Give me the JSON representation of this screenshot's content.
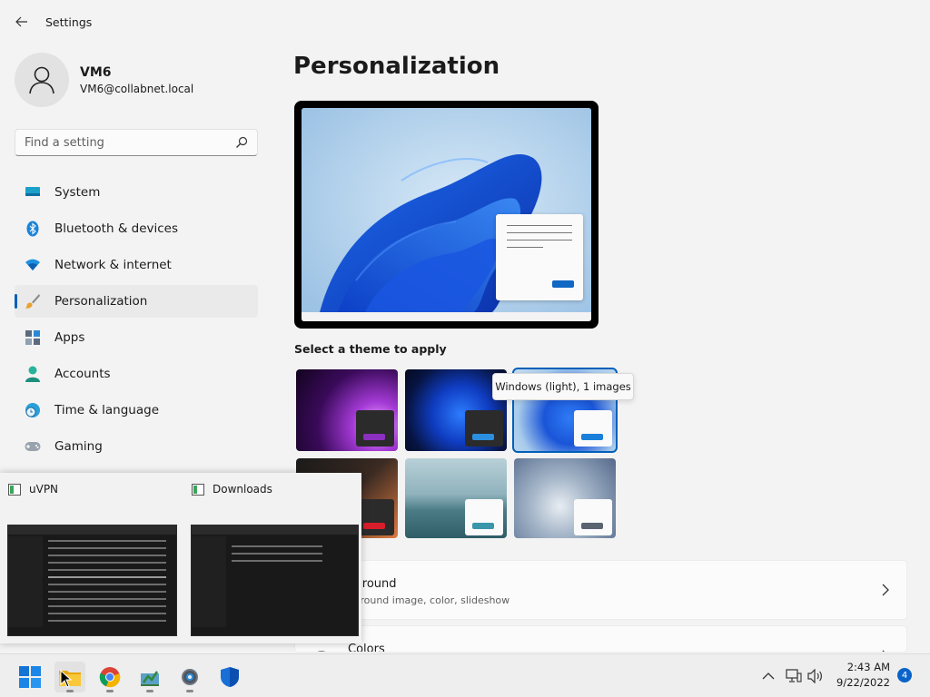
{
  "window": {
    "title": "Settings"
  },
  "user": {
    "name": "VM6",
    "email": "VM6@collabnet.local"
  },
  "search": {
    "placeholder": "Find a setting"
  },
  "nav": [
    {
      "label": "System",
      "icon": "monitor-icon"
    },
    {
      "label": "Bluetooth & devices",
      "icon": "bluetooth-icon"
    },
    {
      "label": "Network & internet",
      "icon": "wifi-icon"
    },
    {
      "label": "Personalization",
      "icon": "brush-icon",
      "selected": true
    },
    {
      "label": "Apps",
      "icon": "apps-icon"
    },
    {
      "label": "Accounts",
      "icon": "person-icon"
    },
    {
      "label": "Time & language",
      "icon": "clock-globe-icon"
    },
    {
      "label": "Gaming",
      "icon": "gamepad-icon"
    }
  ],
  "main": {
    "title": "Personalization",
    "theme_section_label": "Select a theme to apply",
    "theme_tooltip": "Windows (light), 1 images",
    "cards": [
      {
        "title": "kground",
        "subtitle": "kground image, color, slideshow"
      },
      {
        "title": "Colors"
      }
    ]
  },
  "thumbnails": [
    {
      "title": "uVPN",
      "icon": "folder-icon"
    },
    {
      "title": "Downloads",
      "icon": "folder-icon"
    }
  ],
  "taskbar": {
    "apps": [
      "start-icon",
      "file-explorer-icon",
      "chrome-icon",
      "settings-app-icon",
      "gear-icon",
      "defender-shield-icon"
    ],
    "time": "2:43 AM",
    "date": "9/22/2022",
    "notifications": "4"
  },
  "colors": {
    "accent": "#005fb8"
  }
}
